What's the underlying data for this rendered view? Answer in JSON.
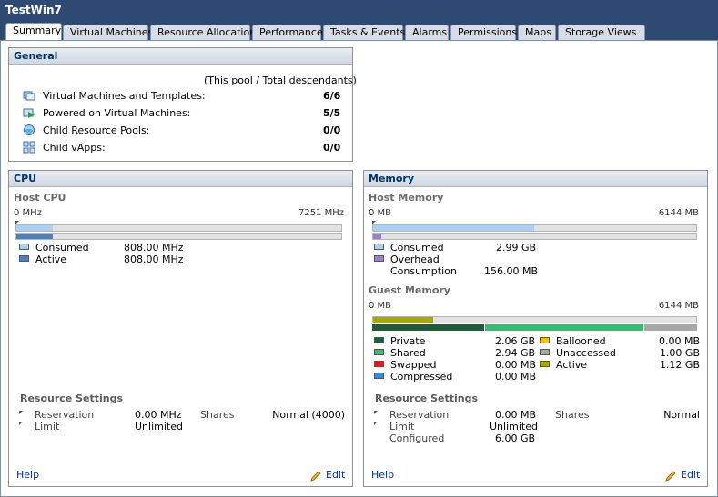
{
  "window": {
    "title": "TestWin7"
  },
  "tabs": [
    "Summary",
    "Virtual Machines",
    "Resource Allocation",
    "Performance",
    "Tasks & Events",
    "Alarms",
    "Permissions",
    "Maps",
    "Storage Views"
  ],
  "general": {
    "title": "General",
    "column_header": "(This pool / Total descendants)",
    "rows": [
      {
        "label": "Virtual Machines and Templates:",
        "value": "6/6",
        "icon": "vm-template-icon"
      },
      {
        "label": "Powered on Virtual Machines:",
        "value": "5/5",
        "icon": "powered-on-vm-icon"
      },
      {
        "label": "Child Resource Pools:",
        "value": "0/0",
        "icon": "resource-pool-icon"
      },
      {
        "label": "Child vApps:",
        "value": "0/0",
        "icon": "vapp-icon"
      }
    ]
  },
  "cpu": {
    "title": "CPU",
    "host_label": "Host CPU",
    "min_label": "0 MHz",
    "max_label": "7251 MHz",
    "consumed_fraction": 0.1115,
    "legend": [
      {
        "label": "Consumed",
        "value": "808.00 MHz",
        "color": "#a8d1f5"
      },
      {
        "label": "Active",
        "value": "808.00 MHz",
        "color": "#4f7fb5"
      }
    ],
    "resource_settings_title": "Resource Settings",
    "reservation_label": "Reservation",
    "reservation_value": "0.00 MHz",
    "limit_label": "Limit",
    "limit_value": "Unlimited",
    "shares_label": "Shares",
    "shares_value": "Normal (4000)",
    "help_label": "Help",
    "edit_label": "Edit"
  },
  "memory": {
    "title": "Memory",
    "host_label": "Host Memory",
    "min_label": "0 MB",
    "max_label": "6144 MB",
    "consumed_fraction": 0.4983,
    "overhead_fraction": 0.0254,
    "host_legend": [
      {
        "label": "Consumed",
        "value": "2.99 GB",
        "color": "#a8d1f5"
      },
      {
        "label": "Overhead",
        "value": "",
        "color": "#9b82c2"
      },
      {
        "label": "Consumption",
        "value": "156.00 MB",
        "color": ""
      }
    ],
    "guest_label": "Guest Memory",
    "guest_min_label": "0 MB",
    "guest_max_label": "6144 MB",
    "guest_active_fraction": 0.1867,
    "guest_private_fraction": 0.3433,
    "guest_shared_fraction": 0.49,
    "guest_unaccessed_fraction": 0.1667,
    "guest_legend_left": [
      {
        "label": "Private",
        "value": "2.06 GB",
        "color": "#1e5c3a"
      },
      {
        "label": "Shared",
        "value": "2.94 GB",
        "color": "#2fbf71"
      },
      {
        "label": "Swapped",
        "value": "0.00 MB",
        "color": "#e81818"
      },
      {
        "label": "Compressed",
        "value": "0.00 MB",
        "color": "#1e90ff"
      }
    ],
    "guest_legend_right": [
      {
        "label": "Ballooned",
        "value": "0.00 MB",
        "color": "#f2c500"
      },
      {
        "label": "Unaccessed",
        "value": "1.00 GB",
        "color": "#a8a8a8"
      },
      {
        "label": "Active",
        "value": "1.12 GB",
        "color": "#a8a800"
      }
    ],
    "resource_settings_title": "Resource Settings",
    "reservation_label": "Reservation",
    "reservation_value": "0.00 MB",
    "limit_label": "Limit",
    "limit_value": "Unlimited",
    "configured_label": "Configured",
    "configured_value": "6.00 GB",
    "shares_label": "Shares",
    "shares_value": "Normal",
    "help_label": "Help",
    "edit_label": "Edit"
  }
}
